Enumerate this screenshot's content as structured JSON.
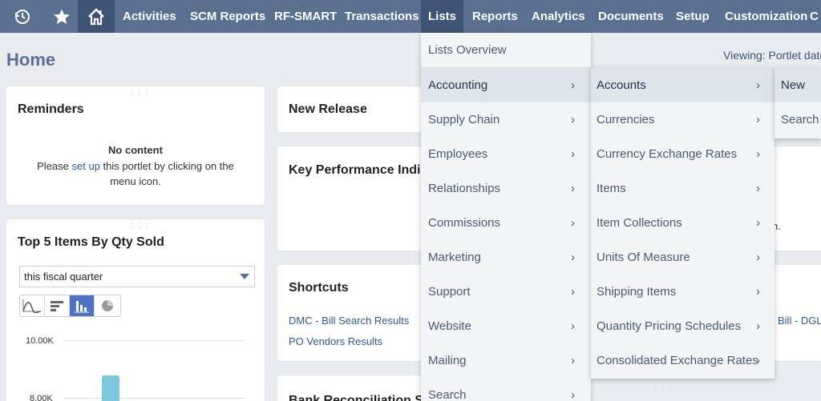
{
  "nav": {
    "icons": [
      "recent-icon",
      "star-icon",
      "home-icon"
    ],
    "items": [
      "Activities",
      "SCM Reports",
      "RF-SMART",
      "Transactions",
      "Lists",
      "Reports",
      "Analytics",
      "Documents",
      "Setup",
      "Customization"
    ],
    "active": "Lists"
  },
  "page": {
    "title": "Home",
    "viewing": "Viewing: Portlet date"
  },
  "reminders": {
    "title": "Reminders",
    "no_content": "No content",
    "line1_pre": "Please ",
    "line1_link": "set up",
    "line1_post": " this portlet by clicking on the",
    "line2": "menu icon."
  },
  "top_items": {
    "title": "Top 5 Items By Qty Sold",
    "period": "this fiscal quarter",
    "chart_icons": [
      "line-chart-icon",
      "horizontal-bar-icon",
      "bar-chart-icon",
      "pie-chart-icon"
    ],
    "y_ticks": [
      "10.00K",
      "8.00K"
    ]
  },
  "new_release": {
    "title": "New Release"
  },
  "kpi": {
    "title": "Key Performance Indic",
    "fragment": "n."
  },
  "shortcuts": {
    "title": "Shortcuts",
    "links": [
      "DMC - Bill Search Results",
      "PO Vendors Results"
    ],
    "right_link": "Bill - DGLY"
  },
  "bottom_portlet": {
    "title": "Bank Reconciliation Se"
  },
  "menu_lists": {
    "overview": "Lists Overview",
    "items": [
      "Accounting",
      "Supply Chain",
      "Employees",
      "Relationships",
      "Commissions",
      "Marketing",
      "Support",
      "Website",
      "Mailing",
      "Search"
    ]
  },
  "menu_accounting": {
    "items": [
      "Accounts",
      "Currencies",
      "Currency Exchange Rates",
      "Items",
      "Item Collections",
      "Units Of Measure",
      "Shipping Items",
      "Quantity Pricing Schedules",
      "Consolidated Exchange Rates"
    ]
  },
  "menu_accounts": {
    "items": [
      "New",
      "Search"
    ]
  },
  "colors": {
    "nav": "#5b6f91",
    "nav_active": "#3e5375",
    "menu_bg": "#f3f4f6",
    "highlight": "#dfe3ea",
    "bar": "#7ac7de"
  }
}
